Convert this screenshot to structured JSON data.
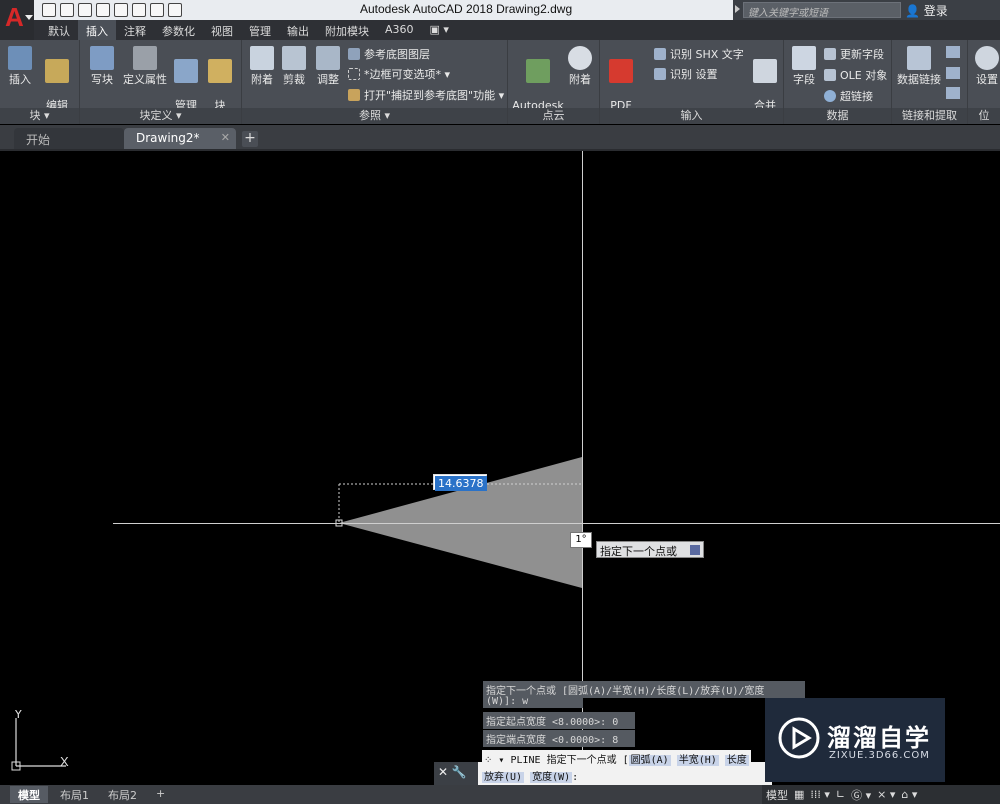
{
  "window": {
    "title": "Autodesk AutoCAD 2018    Drawing2.dwg",
    "search_placeholder": "键入关键字或短语",
    "login": "登录"
  },
  "ribbon_tabs": [
    "默认",
    "插入",
    "注释",
    "参数化",
    "视图",
    "管理",
    "输出",
    "附加模块",
    "A360",
    "▣ ▾"
  ],
  "active_tab_index": 1,
  "ribbon": {
    "block": {
      "title": "块 ▾",
      "insert": "插入",
      "edit_attr": "编辑\n属性"
    },
    "block_def": {
      "title": "块定义 ▾",
      "write": "写块",
      "define_attr": "定义属性",
      "manage_attr": "管理\n属性",
      "block_editor": "块\n编辑器"
    },
    "reference": {
      "title": "参照 ▾",
      "attach": "附着",
      "clip": "剪裁",
      "adjust": "调整",
      "underlay_layers": "参考底图图层",
      "frames_variable": "*边框可变选项* ▾",
      "snap_underlay": "打开\"捕捉到参考底图\"功能 ▾"
    },
    "pointcloud": {
      "title": "点云",
      "recap": "Autodesk\nReCap",
      "attach": "附着"
    },
    "import": {
      "title": "输入",
      "pdf_import": "PDF\n输入",
      "recognize_shx": "识别 SHX 文字",
      "recognize_settings": "识别 设置",
      "combine_text": "合并\n文字"
    },
    "data": {
      "title": "数据",
      "field": "字段",
      "update_fields": "更新字段",
      "ole_object": "OLE 对象",
      "hyperlink": "超链接"
    },
    "link_extract": {
      "title": "链接和提取",
      "data_link": "数据链接"
    },
    "location": {
      "title": "位",
      "settings": "设置"
    }
  },
  "file_tabs": [
    {
      "label": "开始",
      "active": false
    },
    {
      "label": "Drawing2*",
      "active": true,
      "close": "✕"
    }
  ],
  "tab_add": "+",
  "viewport": {
    "dynamic_length": "14.6378",
    "angle_tooltip": "1°",
    "prompt_tooltip": "指定下一个点或"
  },
  "command_history": [
    "指定下一个点或 [圆弧(A)/半宽(H)/长度(L)/放弃(U)/宽度",
    "(W)]: w",
    "指定起点宽度 <8.0000>: 0",
    "指定端点宽度 <0.0000>: 8"
  ],
  "command_line": {
    "tools": "✕ 🔧",
    "line1_prefix": "⁘ ▾ PLINE 指定下一个点或 [",
    "opt_arc": "圆弧(A)",
    "opt_half": "半宽(H)",
    "opt_length": "长度",
    "opt_undo": "放弃(U)",
    "opt_width": "宽度(W)",
    "line2_suffix": ":"
  },
  "ucs": {
    "x": "X",
    "y": "Y"
  },
  "watermark": {
    "title": "溜溜自学",
    "url": "ZIXUE.3D66.COM"
  },
  "status_tabs": [
    "模型",
    "布局1",
    "布局2",
    "+"
  ],
  "status_right": {
    "model": "模型",
    "grid": "▦",
    "snap": "⁞⁞⁞ ▾",
    "ortho": "∟",
    "polar": "Ⓖ ▾",
    "osnap": "⨯ ▾",
    "ann": "⌂ ▾"
  },
  "colors": {
    "accent": "#d62828",
    "ribbon": "#4a4e55",
    "viewport": "#000000",
    "selection": "#2a72c8"
  }
}
